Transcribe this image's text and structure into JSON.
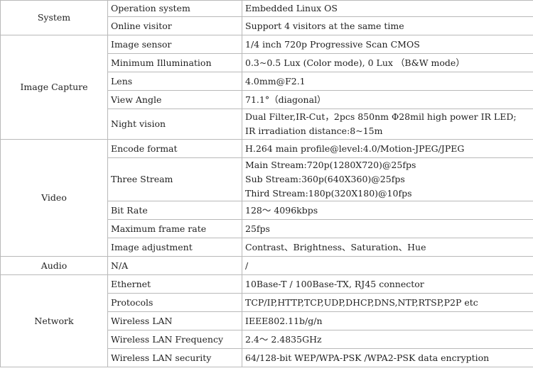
{
  "rows": [
    {
      "category": "System",
      "items": [
        {
          "name": "Operation system",
          "lines": [
            "Embedded Linux OS"
          ]
        },
        {
          "name": "Online visitor",
          "lines": [
            "Support 4 visitors at the same time"
          ]
        }
      ]
    },
    {
      "category": "Image Capture",
      "items": [
        {
          "name": "Image sensor",
          "lines": [
            "1/4 inch 720p Progressive Scan CMOS"
          ]
        },
        {
          "name": "Minimum Illumination",
          "lines": [
            "0.3~0.5 Lux (Color mode), 0 Lux （B&W mode）"
          ]
        },
        {
          "name": "Lens",
          "lines": [
            "4.0mm@F2.1"
          ]
        },
        {
          "name": "View Angle",
          "lines": [
            "71.1°（diagonal）"
          ]
        },
        {
          "name": "Night vision",
          "lines": [
            "Dual Filter,IR-Cut，2pcs 850nm Φ28mil high power IR LED;",
            "IR irradiation distance:8~15m"
          ]
        }
      ]
    },
    {
      "category": "Video",
      "items": [
        {
          "name": "Encode format",
          "lines": [
            "H.264 main profile@level:4.0/Motion-JPEG/JPEG"
          ]
        },
        {
          "name": "Three Stream",
          "lines": [
            "Main Stream:720p(1280X720)@25fps",
            "Sub Stream:360p(640X360)@25fps",
            "Third Stream:180p(320X180)@10fps"
          ]
        },
        {
          "name": "Bit Rate",
          "lines": [
            "128～ 4096kbps"
          ]
        },
        {
          "name": "Maximum frame rate",
          "lines": [
            "25fps"
          ]
        },
        {
          "name": "Image adjustment",
          "lines": [
            "Contrast、Brightness、Saturation、Hue"
          ]
        }
      ]
    },
    {
      "category": "Audio",
      "items": [
        {
          "name": "N/A",
          "lines": [
            "/"
          ]
        }
      ]
    },
    {
      "category": "Network",
      "items": [
        {
          "name": "Ethernet",
          "lines": [
            "10Base-T / 100Base-TX, RJ45 connector"
          ]
        },
        {
          "name": "Protocols",
          "lines": [
            "TCP/IP,HTTP,TCP,UDP,DHCP,DNS,NTP,RTSP,P2P etc"
          ]
        },
        {
          "name": "Wireless LAN",
          "lines": [
            "IEEE802.11b/g/n"
          ]
        },
        {
          "name": "Wireless LAN Frequency",
          "lines": [
            "2.4～ 2.4835GHz"
          ]
        },
        {
          "name": "Wireless LAN security",
          "lines": [
            "64/128-bit WEP/WPA-PSK /WPA2-PSK data encryption"
          ]
        }
      ]
    }
  ]
}
